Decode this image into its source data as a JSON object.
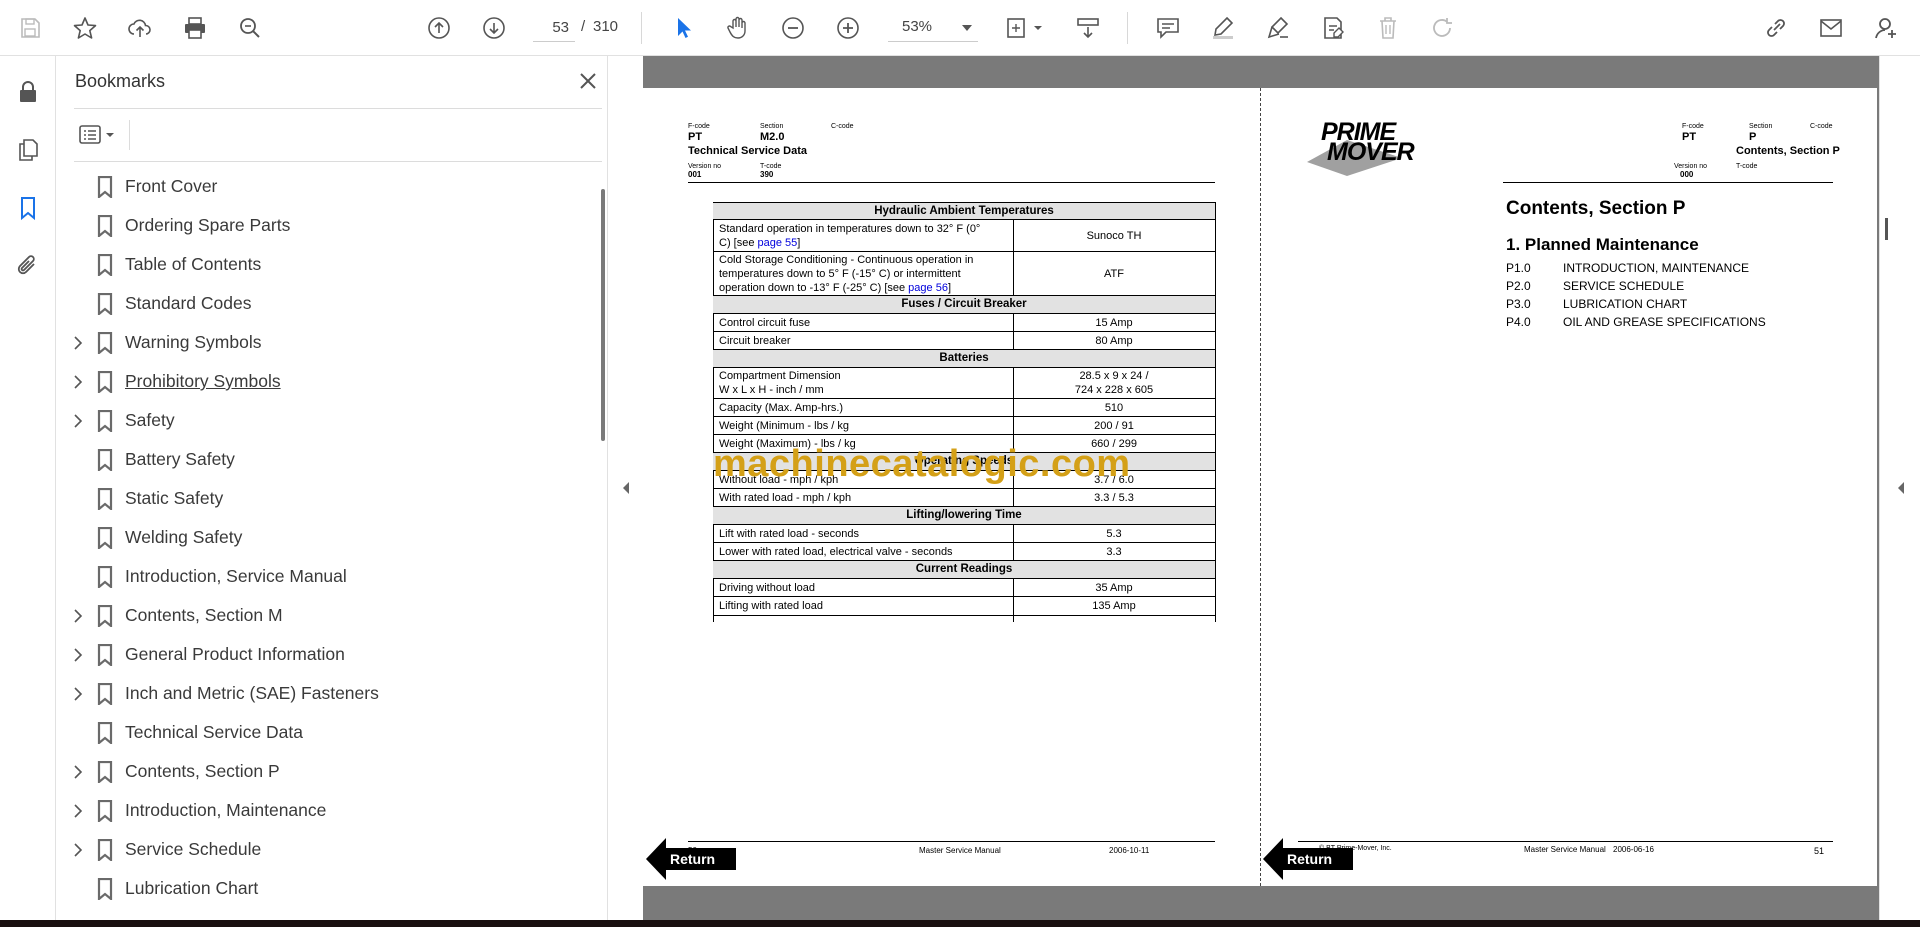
{
  "toolbar": {
    "current_page": "53",
    "page_separator": "/",
    "total_pages": "310",
    "zoom": "53%"
  },
  "bookmarks": {
    "title": "Bookmarks",
    "items": [
      {
        "label": "Front Cover",
        "expandable": false
      },
      {
        "label": "Ordering Spare Parts",
        "expandable": false
      },
      {
        "label": "Table of Contents",
        "expandable": false
      },
      {
        "label": "Standard Codes",
        "expandable": false
      },
      {
        "label": "Warning Symbols",
        "expandable": true
      },
      {
        "label": "Prohibitory Symbols",
        "expandable": true
      },
      {
        "label": "Safety",
        "expandable": true
      },
      {
        "label": "Battery Safety",
        "expandable": false
      },
      {
        "label": "Static Safety",
        "expandable": false
      },
      {
        "label": "Welding Safety",
        "expandable": false
      },
      {
        "label": "Introduction, Service Manual",
        "expandable": false
      },
      {
        "label": "Contents, Section M",
        "expandable": true
      },
      {
        "label": "General Product Information",
        "expandable": true
      },
      {
        "label": "Inch and Metric (SAE) Fasteners",
        "expandable": true
      },
      {
        "label": "Technical Service Data",
        "expandable": false
      },
      {
        "label": "Contents, Section P",
        "expandable": true
      },
      {
        "label": "Introduction, Maintenance",
        "expandable": true
      },
      {
        "label": "Service Schedule",
        "expandable": true
      },
      {
        "label": "Lubrication Chart",
        "expandable": false
      }
    ]
  },
  "left_page": {
    "fcode_label": "F-code",
    "fcode": "PT",
    "section_label": "Section",
    "section": "M2.0",
    "ccode_label": "C-code",
    "heading": "Technical Service Data",
    "version_label": "Version no",
    "version": "001",
    "tcode_label": "T-code",
    "tcode": "390",
    "sections": {
      "hydraulic": "Hydraulic Ambient Temperatures",
      "fuses": "Fuses / Circuit Breaker",
      "batteries": "Batteries",
      "speeds": "Operating Speeds",
      "lifting": "Lifting/lowering Time",
      "current": "Current Readings"
    },
    "rows": {
      "std_op_1": "Standard operation in temperatures down to 32° F (0°",
      "std_op_2": "C) [see ",
      "std_op_link": "page 55",
      "std_op_3": "]",
      "std_op_val": "Sunoco TH",
      "cold_1": "Cold Storage Conditioning - Continuous operation in",
      "cold_2": "temperatures down to 5° F (-15° C) or intermittent",
      "cold_3": "operation down to -13° F (-25° C) [see ",
      "cold_link": "page 56",
      "cold_4": "]",
      "cold_val": "ATF",
      "fuse": "Control circuit fuse",
      "fuse_val": "15 Amp",
      "breaker": "Circuit breaker",
      "breaker_val": "80 Amp",
      "comp_1": "Compartment Dimension",
      "comp_2": "W x L x H - inch / mm",
      "comp_val1": "28.5 x 9 x 24 /",
      "comp_val2": "724 x 228 x 605",
      "cap": "Capacity (Max. Amp-hrs.)",
      "cap_val": "510",
      "wmin": "Weight (Minimum - lbs / kg",
      "wmin_val": "200 / 91",
      "wmax": "Weight (Maximum) - lbs / kg",
      "wmax_val": "660 / 299",
      "noload": "Without load - mph / kph",
      "noload_val": "3.7 / 6.0",
      "rated": "With rated load - mph / kph",
      "rated_val": "3.3 / 5.3",
      "lift": "Lift with rated load - seconds",
      "lift_val": "5.3",
      "lower": "Lower with rated load, electrical valve - seconds",
      "lower_val": "3.3",
      "drive": "Driving without load",
      "drive_val": "35 Amp",
      "liftload": "Lifting with rated load",
      "liftload_val": "135 Amp"
    },
    "footer_page": "50",
    "footer_title": "Master Service Manual",
    "footer_date": "2006-10-11",
    "return_label": "Return"
  },
  "watermark": "machinecatalogic.com",
  "right_page": {
    "logo_line1": "PRIME",
    "logo_line2": "MOVER",
    "fcode_label": "F-code",
    "fcode": "PT",
    "section_label": "Section",
    "section": "P",
    "ccode_label": "C-code",
    "heading": "Contents, Section P",
    "version_label": "Version no",
    "version": "000",
    "tcode_label": "T-code",
    "title": "Contents, Section P",
    "subtitle": "1. Planned Maintenance",
    "toc": [
      {
        "num": "P1.0",
        "text": "INTRODUCTION, MAINTENANCE"
      },
      {
        "num": "P2.0",
        "text": "SERVICE SCHEDULE"
      },
      {
        "num": "P3.0",
        "text": "LUBRICATION CHART"
      },
      {
        "num": "P4.0",
        "text": "OIL AND GREASE SPECIFICATIONS"
      }
    ],
    "footer_copy": "© BT Prime-Mover, Inc.",
    "footer_title": "Master Service Manual",
    "footer_date": "2006-06-16",
    "footer_page": "51",
    "return_label": "Return"
  },
  "colors": {
    "accent": "#1a73e8",
    "watermark": "#d4a017"
  }
}
